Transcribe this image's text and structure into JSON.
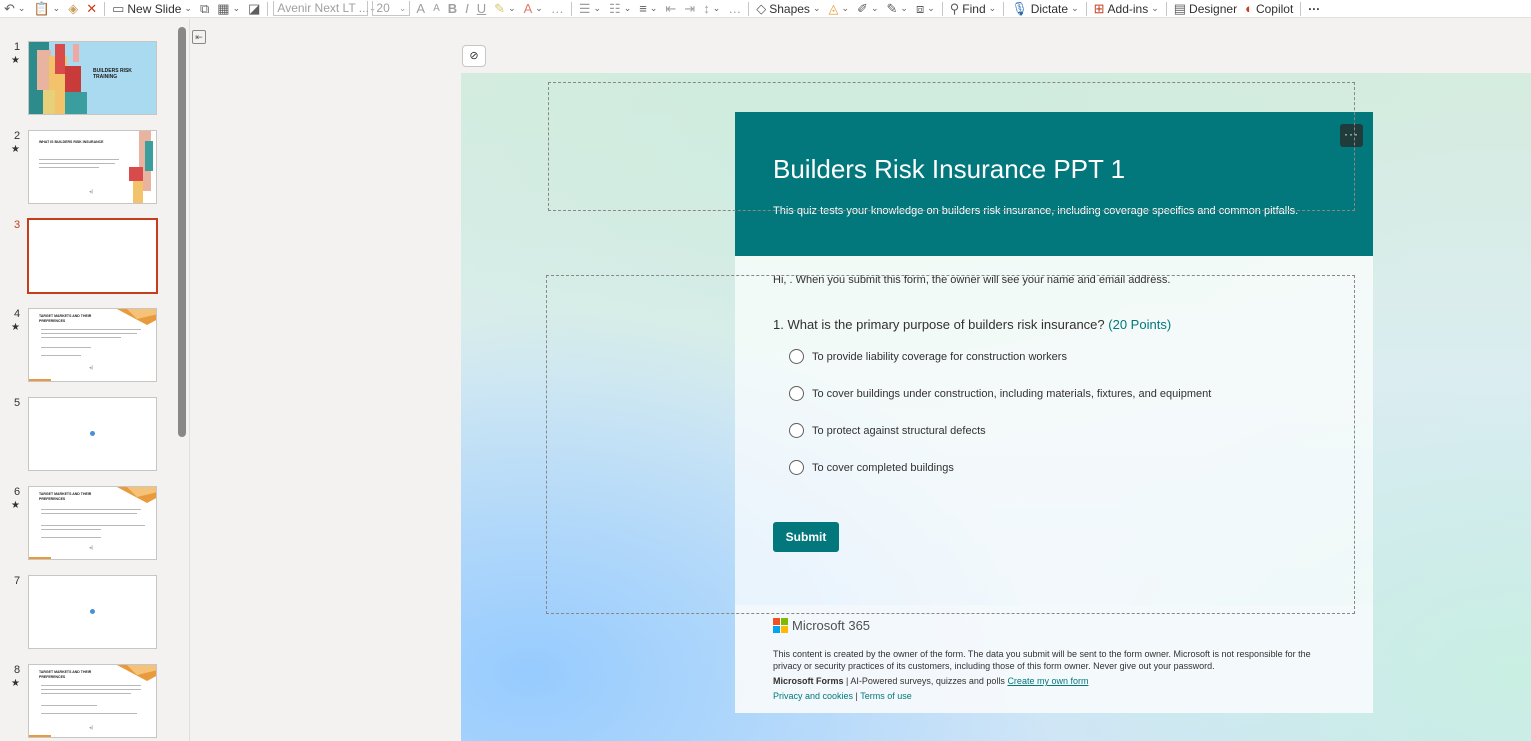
{
  "ribbon": {
    "new_slide": "New Slide",
    "font_name": "Avenir Next LT ...",
    "font_size": "20",
    "shapes": "Shapes",
    "find": "Find",
    "dictate": "Dictate",
    "addins": "Add-ins",
    "designer": "Designer",
    "copilot": "Copilot",
    "more": "···"
  },
  "slides": [
    {
      "num": "1",
      "star": "★",
      "title": "BUILDERS RISK TRAINING"
    },
    {
      "num": "2",
      "star": "★",
      "title": "WHAT IS BUILDERS RISK INSURANCE"
    },
    {
      "num": "3",
      "star": ""
    },
    {
      "num": "4",
      "star": "★",
      "title": "TARGET MARKETS AND THEIR PREFERENCES"
    },
    {
      "num": "5",
      "star": ""
    },
    {
      "num": "6",
      "star": "★",
      "title": "TARGET MARKETS AND THEIR PREFERENCES"
    },
    {
      "num": "7",
      "star": ""
    },
    {
      "num": "8",
      "star": "★",
      "title": "TARGET MARKETS AND THEIR PREFERENCES"
    }
  ],
  "form": {
    "title": "Builders Risk Insurance PPT 1",
    "description": "This quiz tests your knowledge on builders risk insurance, including coverage specifics and common pitfalls.",
    "more_label": "···",
    "greeting": "Hi, . When you submit this form, the owner will see your name and email address.",
    "question": "1. What is the primary purpose of builders risk insurance?",
    "points": "(20 Points)",
    "options": [
      "To provide liability coverage for construction workers",
      "To cover buildings under construction, including materials, fixtures, and equipment",
      "To protect against structural defects",
      "To cover completed buildings"
    ],
    "submit": "Submit"
  },
  "footer": {
    "brand": "Microsoft 365",
    "disclaimer_1": "This content is created by the owner of the form. The data you submit will be sent to the form owner. Microsoft is not responsible for the",
    "disclaimer_2": "privacy or security practices of its customers, including those of this form owner. Never give out your password.",
    "forms_name": "Microsoft Forms",
    "forms_tagline": " | AI-Powered surveys, quizzes and polls ",
    "create_link": "Create my own form",
    "privacy_link": "Privacy and cookies",
    "divider": " | ",
    "terms_link": "Terms of use"
  },
  "colors": {
    "accent": "#03787c",
    "selected_slide_border": "#c43e1c",
    "ms_red": "#f25022",
    "ms_green": "#7fba00",
    "ms_blue": "#00a4ef",
    "ms_yellow": "#ffb900"
  }
}
